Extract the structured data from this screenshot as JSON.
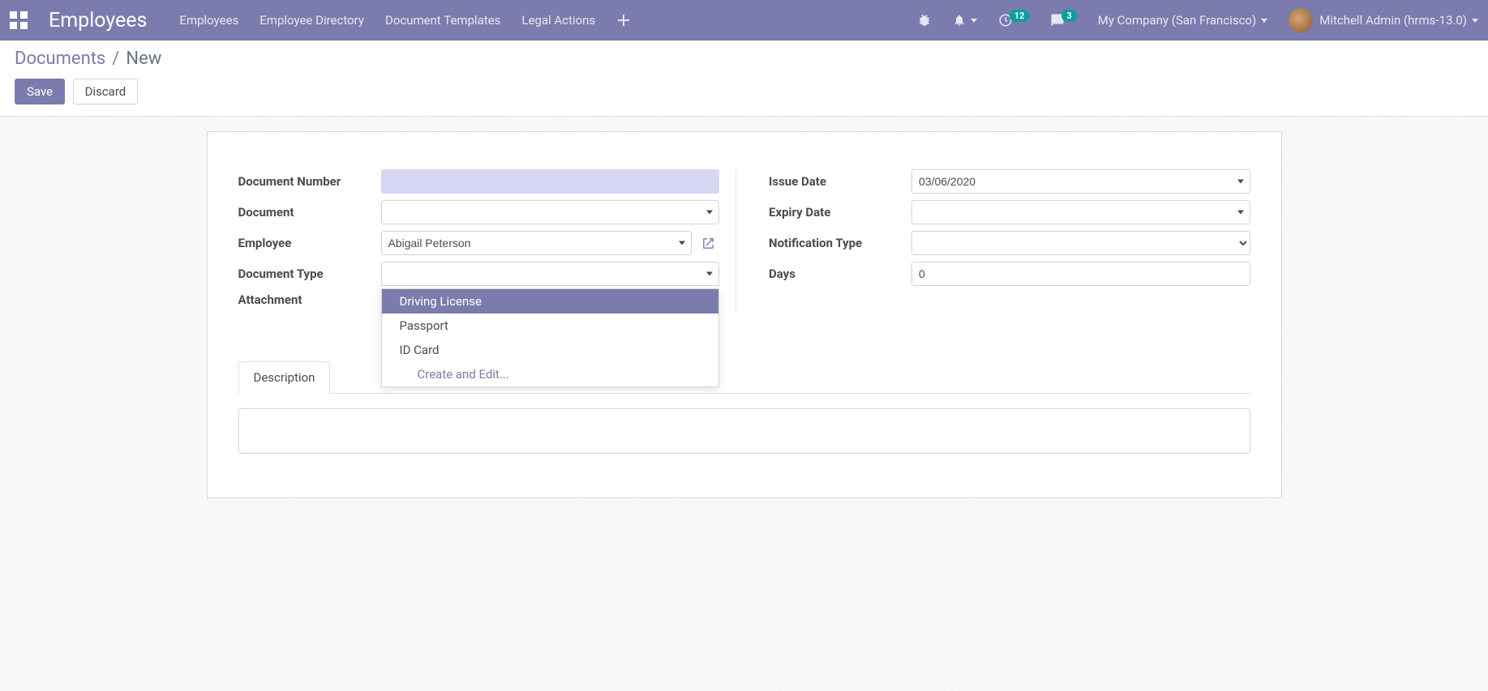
{
  "topbar": {
    "brand": "Employees",
    "nav": {
      "employees": "Employees",
      "directory": "Employee Directory",
      "templates": "Document Templates",
      "legal": "Legal Actions"
    },
    "activity_badge": "12",
    "discuss_badge": "3",
    "company": "My Company (San Francisco)",
    "user": "Mitchell Admin (hrms-13.0)"
  },
  "breadcrumb": {
    "root": "Documents",
    "current": "New"
  },
  "buttons": {
    "save": "Save",
    "discard": "Discard"
  },
  "form": {
    "labels": {
      "doc_number": "Document Number",
      "document": "Document",
      "employee": "Employee",
      "doc_type": "Document Type",
      "attachment": "Attachment",
      "issue_date": "Issue Date",
      "expiry_date": "Expiry Date",
      "notification_type": "Notification Type",
      "days": "Days"
    },
    "values": {
      "doc_number": "",
      "document": "",
      "employee": "Abigail Peterson",
      "doc_type": "",
      "issue_date": "03/06/2020",
      "expiry_date": "",
      "notification_type": "",
      "days": "0"
    },
    "doc_type_options": {
      "opt1": "Driving License",
      "opt2": "Passport",
      "opt3": "ID Card",
      "action": "Create and Edit..."
    }
  },
  "tabs": {
    "description": "Description"
  }
}
